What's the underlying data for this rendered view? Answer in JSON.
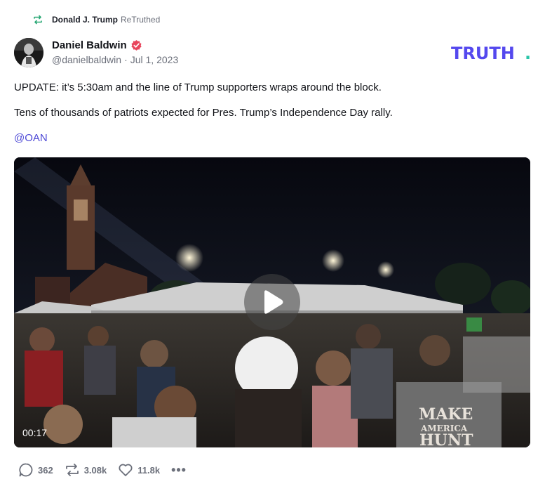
{
  "retruth": {
    "user": "Donald J. Trump",
    "label": "ReTruthed",
    "icon": "retruth-icon"
  },
  "author": {
    "name": "Daniel Baldwin",
    "handle": "@danielbaldwin",
    "separator": "·",
    "date": "Jul 1, 2023",
    "verified_icon": "verified-badge-icon"
  },
  "brand": {
    "logo": "TRUTH",
    "dot": ".",
    "color": "#5448ee",
    "accent": "#29c5a8"
  },
  "post": {
    "paragraphs": [
      "UPDATE: it’s 5:30am and the line of Trump supporters wraps around the block.",
      "Tens of thousands of patriots expected for Pres. Trump’s Independence Day rally."
    ],
    "mention": "@OAN"
  },
  "video": {
    "duration": "00:17",
    "play_icon": "play-icon",
    "shirt_text": [
      "MAKE",
      "AMERICA",
      "HUNT"
    ]
  },
  "actions": {
    "replies": "362",
    "retruths": "3.08k",
    "likes": "11.8k",
    "more": "•••"
  }
}
